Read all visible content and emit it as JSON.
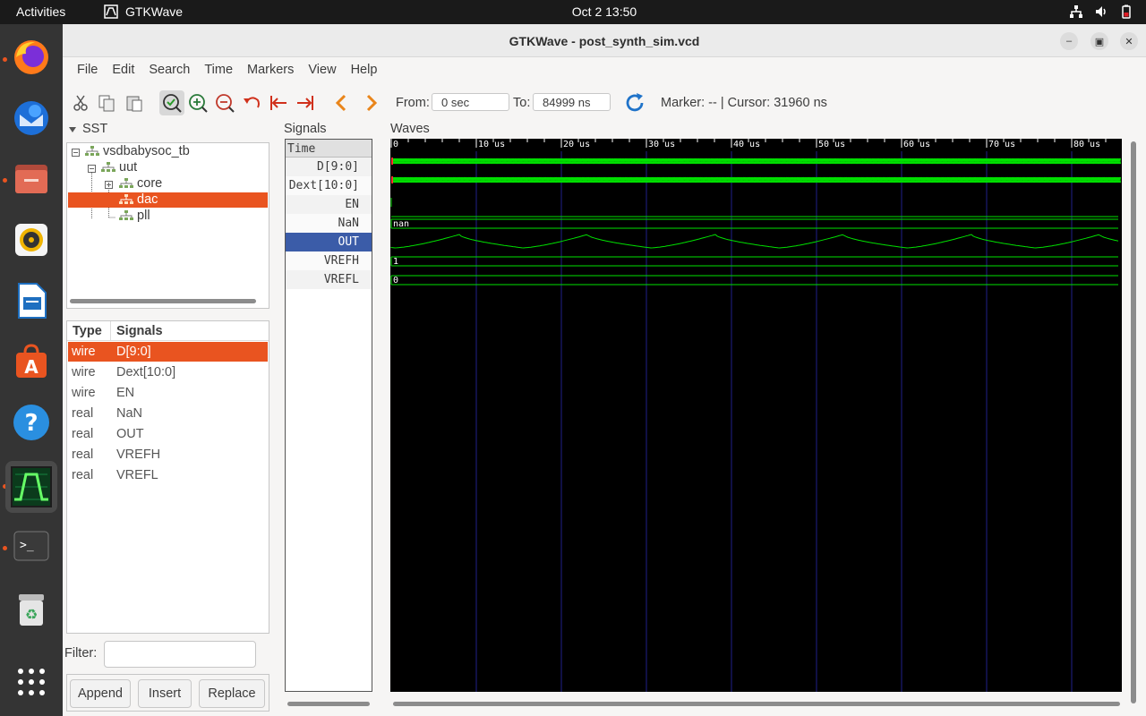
{
  "topbar": {
    "activities": "Activities",
    "app_name": "GTKWave",
    "clock": "Oct 2  13:50"
  },
  "window": {
    "title": "GTKWave - post_synth_sim.vcd"
  },
  "menu": [
    "File",
    "Edit",
    "Search",
    "Time",
    "Markers",
    "View",
    "Help"
  ],
  "toolbar": {
    "from_label": "From:",
    "from_value": "0 sec",
    "to_label": "To:",
    "to_value": "84999 ns",
    "marker_text": "Marker: -- | Cursor: 31960 ns"
  },
  "sst": {
    "label": "SST",
    "tree": [
      "vsdbabysoc_tb",
      "uut",
      "core",
      "dac",
      "pll"
    ],
    "table_headers": [
      "Type",
      "Signals"
    ],
    "rows": [
      {
        "type": "wire",
        "signal": "D[9:0]"
      },
      {
        "type": "wire",
        "signal": "Dext[10:0]"
      },
      {
        "type": "wire",
        "signal": "EN"
      },
      {
        "type": "real",
        "signal": "NaN"
      },
      {
        "type": "real",
        "signal": "OUT"
      },
      {
        "type": "real",
        "signal": "VREFH"
      },
      {
        "type": "real",
        "signal": "VREFL"
      }
    ],
    "filter_label": "Filter:",
    "buttons": [
      "Append",
      "Insert",
      "Replace"
    ]
  },
  "signals": {
    "label": "Signals",
    "header": "Time",
    "names": [
      "D[9:0]",
      "Dext[10:0]",
      "EN",
      "NaN",
      "OUT",
      "VREFH",
      "VREFL"
    ]
  },
  "waves": {
    "label": "Waves",
    "ticks": [
      "0",
      "10 us",
      "20 us",
      "30 us",
      "40 us",
      "50 us",
      "60 us",
      "70 us",
      "80 us"
    ],
    "values": {
      "nan": "nan",
      "vrefh": "1",
      "vrefl": "0"
    },
    "colors": {
      "bg": "#000000",
      "trace": "#00e000",
      "grid": "#20208a",
      "ruler": "#ffffff"
    }
  }
}
